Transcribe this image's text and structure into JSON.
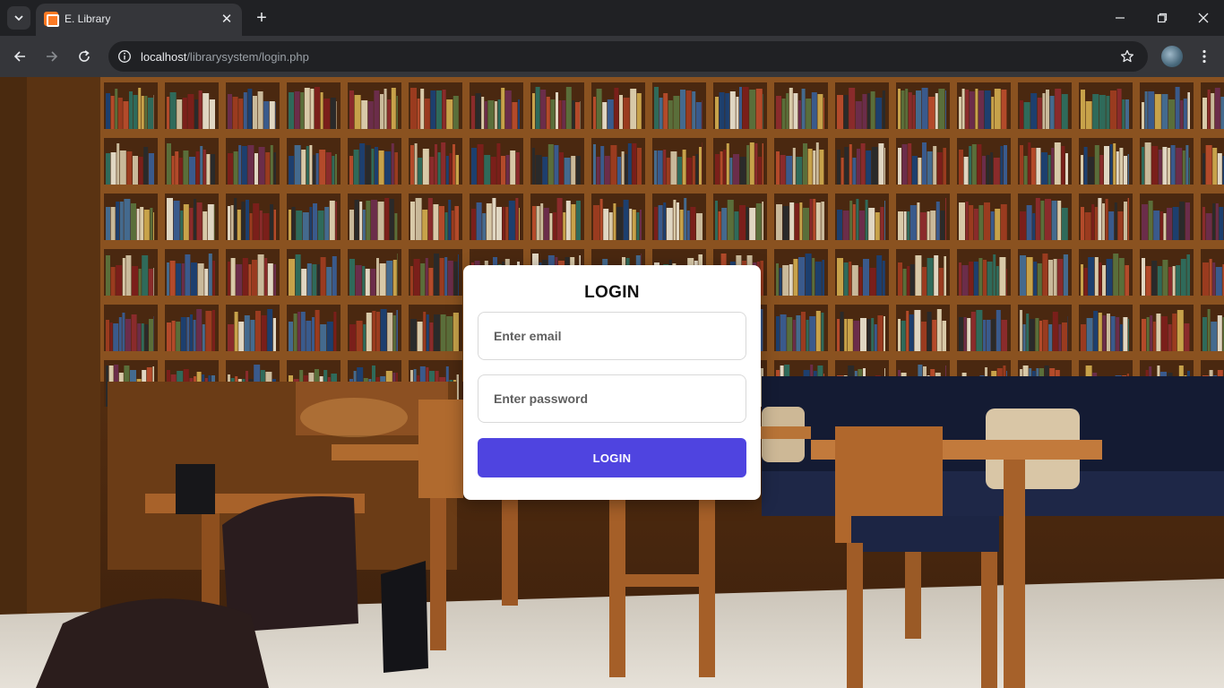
{
  "browser": {
    "tab_title": "E. Library",
    "url_host": "localhost",
    "url_path": "/librarysystem/login.php"
  },
  "login": {
    "title": "LOGIN",
    "email_placeholder": "Enter email",
    "password_placeholder": "Enter password",
    "button_label": "LOGIN"
  },
  "colors": {
    "button": "#4f44e0",
    "card": "#ffffff",
    "favicon": "#fb7a24"
  },
  "icons": [
    "tab-search-icon",
    "xampp-favicon-icon",
    "close-icon",
    "plus-icon",
    "minimize-icon",
    "restore-icon",
    "window-close-icon",
    "back-icon",
    "forward-icon",
    "reload-icon",
    "site-info-icon",
    "bookmark-star-icon",
    "profile-avatar-icon",
    "menu-dots-icon"
  ]
}
